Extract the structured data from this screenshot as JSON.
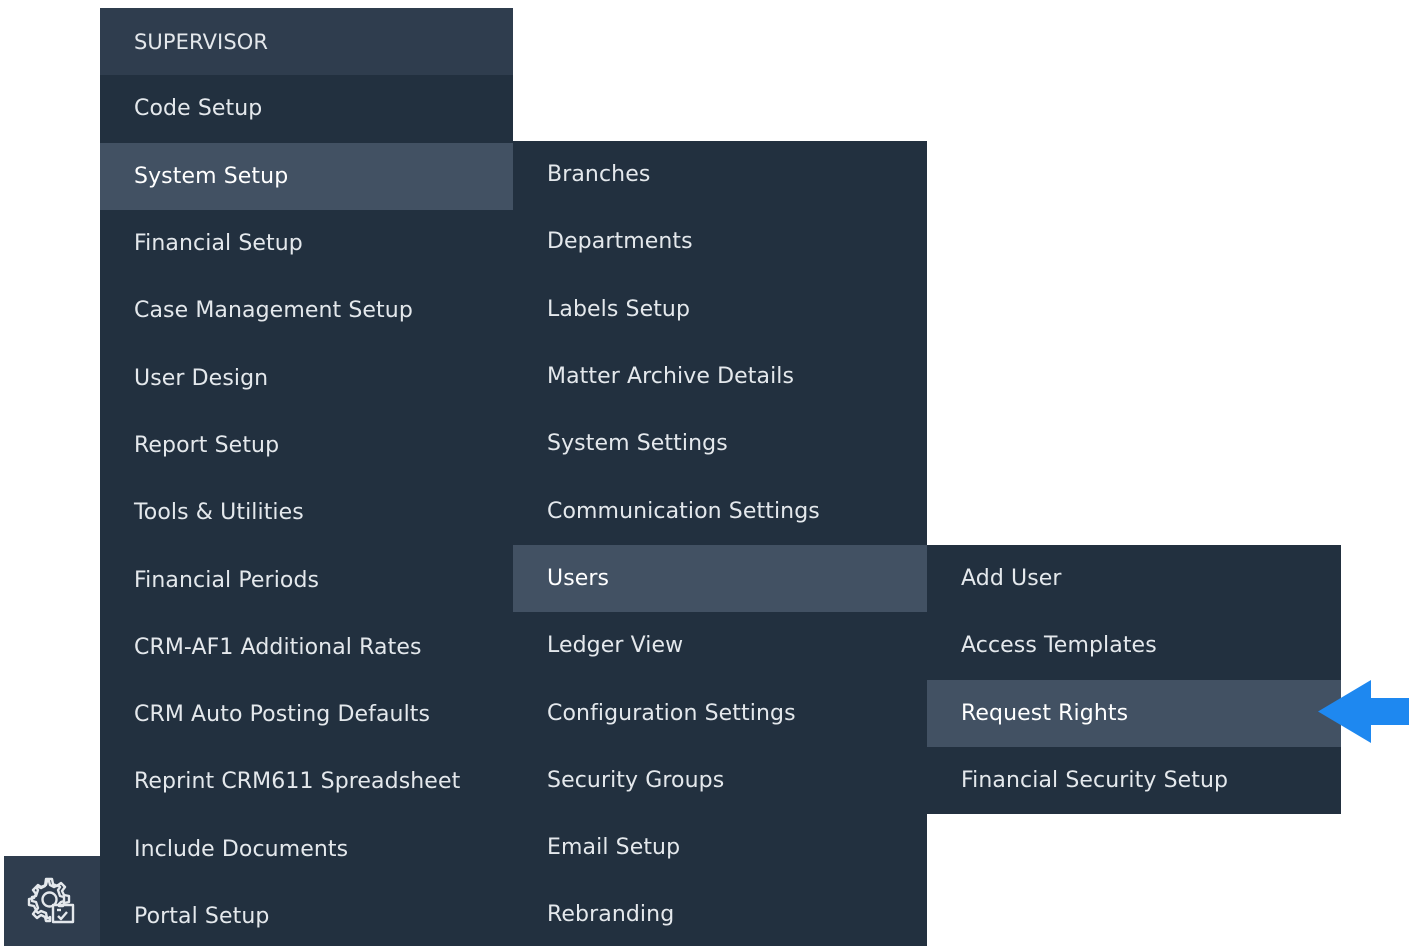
{
  "menu_level_1": {
    "header": "SUPERVISOR",
    "items": [
      {
        "label": "Code Setup"
      },
      {
        "label": "System Setup"
      },
      {
        "label": "Financial Setup"
      },
      {
        "label": "Case Management Setup"
      },
      {
        "label": "User Design"
      },
      {
        "label": "Report Setup"
      },
      {
        "label": "Tools & Utilities"
      },
      {
        "label": "Financial Periods"
      },
      {
        "label": "CRM-AF1 Additional Rates"
      },
      {
        "label": "CRM Auto Posting Defaults"
      },
      {
        "label": "Reprint CRM611 Spreadsheet"
      },
      {
        "label": "Include Documents"
      },
      {
        "label": "Portal Setup"
      }
    ],
    "active_item": "System Setup"
  },
  "menu_level_2": {
    "items": [
      {
        "label": "Branches"
      },
      {
        "label": "Departments"
      },
      {
        "label": "Labels Setup"
      },
      {
        "label": "Matter Archive Details"
      },
      {
        "label": "System Settings"
      },
      {
        "label": "Communication Settings"
      },
      {
        "label": "Users"
      },
      {
        "label": "Ledger View"
      },
      {
        "label": "Configuration Settings"
      },
      {
        "label": "Security Groups"
      },
      {
        "label": "Email Setup"
      },
      {
        "label": "Rebranding"
      }
    ],
    "active_item": "Users"
  },
  "menu_level_3": {
    "items": [
      {
        "label": "Add User"
      },
      {
        "label": "Access Templates"
      },
      {
        "label": "Request Rights"
      },
      {
        "label": "Financial Security Setup"
      }
    ],
    "active_item": "Request Rights"
  },
  "settings_tile": {
    "icon": "settings-gear-icon"
  },
  "pointer": {
    "icon": "arrow-left-icon"
  },
  "colors": {
    "menu_background": "#22303f",
    "menu_header": "#2f3d4e",
    "menu_active": "#425163",
    "menu_text": "#e4e8ec",
    "pointer_arrow": "#1e88f0"
  }
}
